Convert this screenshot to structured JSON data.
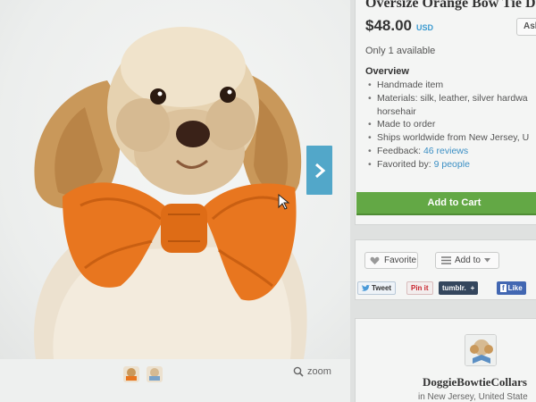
{
  "listing": {
    "title": "Oversize Orange Bow Tie Dog",
    "price": "$48.00",
    "currency": "USD",
    "ask_label": "Ask",
    "availability": "Only 1 available",
    "overview_heading": "Overview",
    "overview": {
      "handmade": "Handmade item",
      "materials_1": "Materials: silk, leather, silver hardwa",
      "materials_2": "horsehair",
      "made_to_order": "Made to order",
      "ships": "Ships worldwide from New Jersey, U",
      "feedback_label": "Feedback:",
      "feedback_link": "46 reviews",
      "favorited_label": "Favorited by:",
      "favorited_link": "9 people"
    },
    "add_to_cart": "Add to Cart"
  },
  "social": {
    "favorite": "Favorite",
    "add_to": "Add to",
    "tweet": "Tweet",
    "pinit": "Pin it",
    "tumblr": "tumblr.",
    "like": "Like"
  },
  "shop": {
    "name": "DoggieBowtieCollars",
    "location": "in New Jersey, United State"
  },
  "gallery": {
    "zoom_label": "zoom"
  },
  "colors": {
    "accent_blue": "#52a7c9",
    "cart_green": "#63a845",
    "bow_orange": "#e8761f",
    "link_blue": "#3b8fc4"
  }
}
